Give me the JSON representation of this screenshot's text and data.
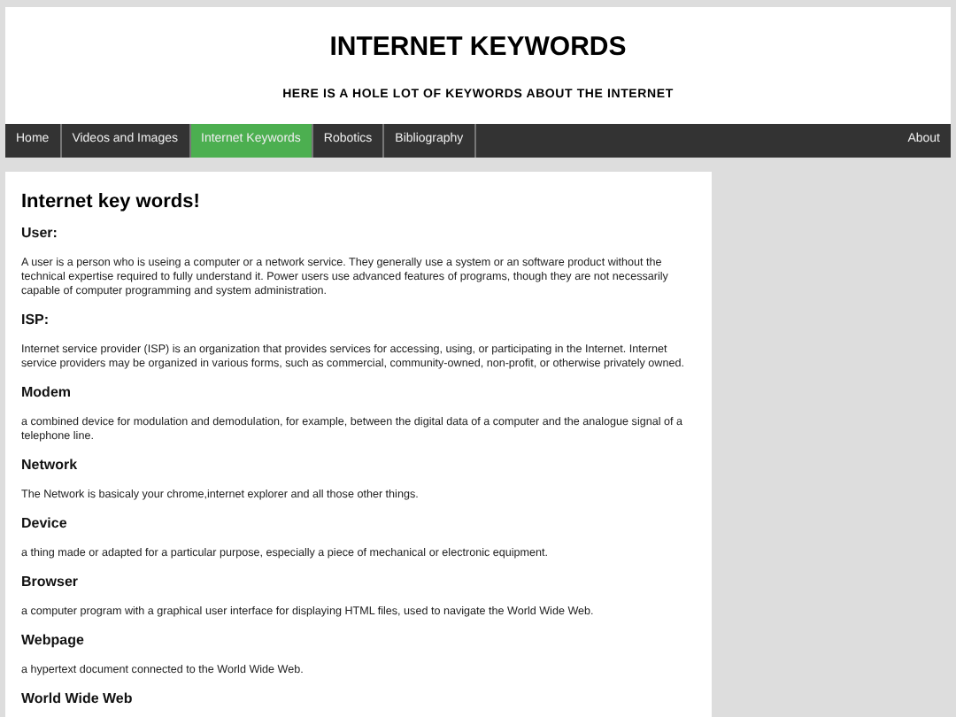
{
  "header": {
    "title": "INTERNET KEYWORDS",
    "subtitle": "HERE IS A HOLE LOT OF KEYWORDS ABOUT THE INTERNET"
  },
  "nav": {
    "items": [
      {
        "label": "Home",
        "selected": false
      },
      {
        "label": "Videos and Images",
        "selected": false
      },
      {
        "label": "Internet Keywords",
        "selected": true
      },
      {
        "label": "Robotics",
        "selected": false
      },
      {
        "label": "Bibliography",
        "selected": false
      }
    ],
    "right_item": {
      "label": "About",
      "selected": false
    }
  },
  "content": {
    "title": "Internet key words!",
    "sections": [
      {
        "heading": "User:",
        "text": "A user is a person who is useing a computer or a network service. They generally use a system or an software product without the technical expertise required to fully understand it. Power users use advanced features of programs, though they are not necessarily capable of computer programming and system administration."
      },
      {
        "heading": "ISP:",
        "text": "Internet service provider (ISP) is an organization that provides services for accessing, using, or participating in the Internet. Internet service providers may be organized in various forms, such as commercial, community-owned, non-profit, or otherwise privately owned."
      },
      {
        "heading": "Modem",
        "text": "a combined device for modulation and demodulation, for example, between the digital data of a computer and the analogue signal of a telephone line."
      },
      {
        "heading": "Network",
        "text": "The Network is basicaly your chrome,internet explorer and all those other things."
      },
      {
        "heading": "Device",
        "text": "a thing made or adapted for a particular purpose, especially a piece of mechanical or electronic equipment."
      },
      {
        "heading": "Browser",
        "text": "a computer program with a graphical user interface for displaying HTML files, used to navigate the World Wide Web."
      },
      {
        "heading": "Webpage",
        "text": "a hypertext document connected to the World Wide Web."
      },
      {
        "heading": "World Wide Web"
      }
    ]
  }
}
